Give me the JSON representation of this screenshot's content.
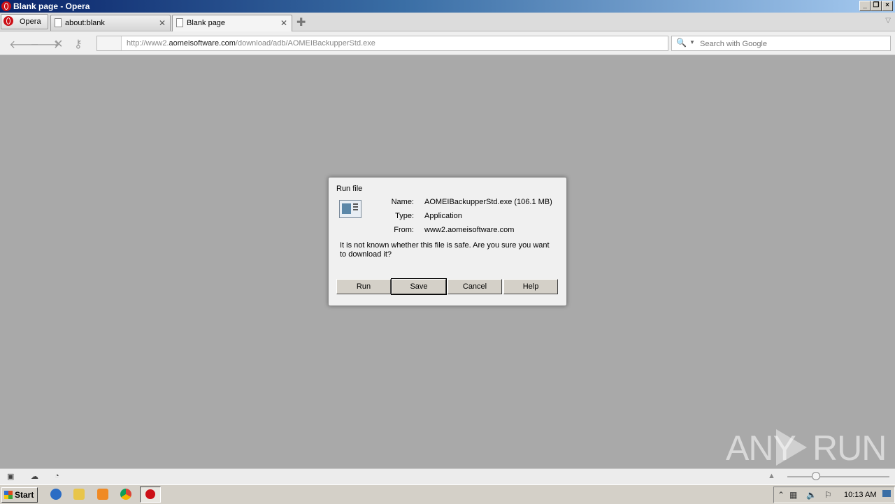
{
  "window": {
    "title": "Blank page - Opera"
  },
  "tabbar": {
    "opera_button": "Opera",
    "tabs": [
      {
        "label": "about:blank",
        "active": false
      },
      {
        "label": "Blank page",
        "active": true
      }
    ]
  },
  "navbar": {
    "address_prefix": "http://www2.",
    "address_domain": "aomeisoftware.com",
    "address_path": "/download/adb/AOMEIBackupperStd.exe",
    "search_placeholder": "Search with Google"
  },
  "dialog": {
    "title": "Run file",
    "name_label": "Name:",
    "name_value": "AOMEIBackupperStd.exe (106.1 MB)",
    "type_label": "Type:",
    "type_value": "Application",
    "from_label": "From:",
    "from_value": "www2.aomeisoftware.com",
    "warning": "It is not known whether this file is safe. Are you sure you want to download it?",
    "buttons": {
      "run": "Run",
      "save": "Save",
      "cancel": "Cancel",
      "help": "Help"
    }
  },
  "watermark": {
    "left": "ANY",
    "right": "RUN"
  },
  "taskbar": {
    "start": "Start",
    "clock": "10:13 AM"
  },
  "colors": {
    "content_bg": "#a9a9a9",
    "opera_red": "#cc0f16",
    "titlebar": "#0a246a"
  }
}
